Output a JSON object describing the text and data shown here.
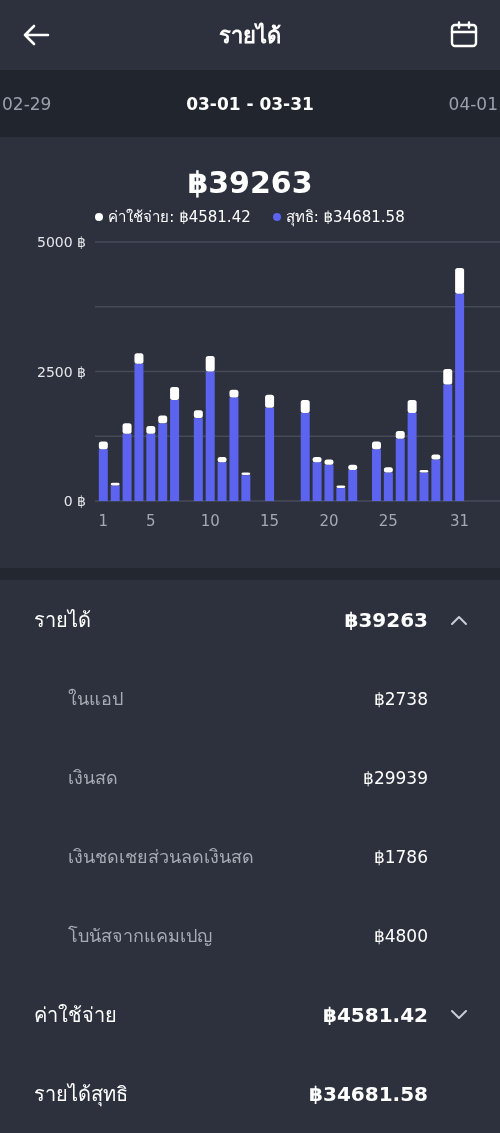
{
  "header": {
    "title": "รายได้"
  },
  "period": {
    "previous": "02-29",
    "current": "03-01 - 03-31",
    "next": "04-01"
  },
  "summary": {
    "total": "฿39263",
    "legend": [
      {
        "label": "ค่าใช้จ่าย: ฿4581.42",
        "color": "#ffffff"
      },
      {
        "label": "สุทธิ: ฿34681.58",
        "color": "#5b63ef"
      }
    ],
    "chart_data": {
      "type": "bar",
      "stacked": true,
      "x": [
        1,
        2,
        3,
        4,
        5,
        6,
        7,
        8,
        9,
        10,
        11,
        12,
        13,
        14,
        15,
        16,
        17,
        18,
        19,
        20,
        21,
        22,
        23,
        24,
        25,
        26,
        27,
        28,
        29,
        30,
        31
      ],
      "xlim": [
        0.3,
        34.4
      ],
      "xticks": [
        1,
        5,
        10,
        15,
        20,
        25,
        31
      ],
      "ylim": [
        0,
        5000
      ],
      "yticks": [
        {
          "value": 0,
          "label": "0 ฿"
        },
        {
          "value": 2500,
          "label": "2500 ฿"
        },
        {
          "value": 5000,
          "label": "5000 ฿"
        }
      ],
      "series": [
        {
          "color": "#5b63ef",
          "values": [
            1000,
            300,
            1300,
            2650,
            1300,
            1500,
            1950,
            0,
            1600,
            2500,
            750,
            2000,
            500,
            0,
            1800,
            0,
            0,
            1700,
            750,
            700,
            250,
            600,
            0,
            1000,
            550,
            1200,
            1700,
            550,
            800,
            2250,
            4000
          ]
        },
        {
          "color": "#ffffff",
          "values": [
            150,
            50,
            200,
            200,
            150,
            150,
            250,
            0,
            150,
            300,
            100,
            150,
            50,
            0,
            250,
            0,
            0,
            250,
            100,
            100,
            50,
            100,
            0,
            150,
            100,
            150,
            250,
            50,
            100,
            300,
            500
          ]
        }
      ]
    }
  },
  "breakdown": [
    {
      "label": "รายได้",
      "amount": "฿39263",
      "expanded": true,
      "children": [
        {
          "label": "ในแอป",
          "amount": "฿2738"
        },
        {
          "label": "เงินสด",
          "amount": "฿29939"
        },
        {
          "label": "เงินชดเชยส่วนลดเงินสด",
          "amount": "฿1786"
        },
        {
          "label": "โบนัสจากแคมเปญ",
          "amount": "฿4800"
        }
      ]
    },
    {
      "label": "ค่าใช้จ่าย",
      "amount": "฿4581.42",
      "expanded": false
    },
    {
      "label": "รายได้สุทธิ",
      "amount": "฿34681.58"
    }
  ]
}
